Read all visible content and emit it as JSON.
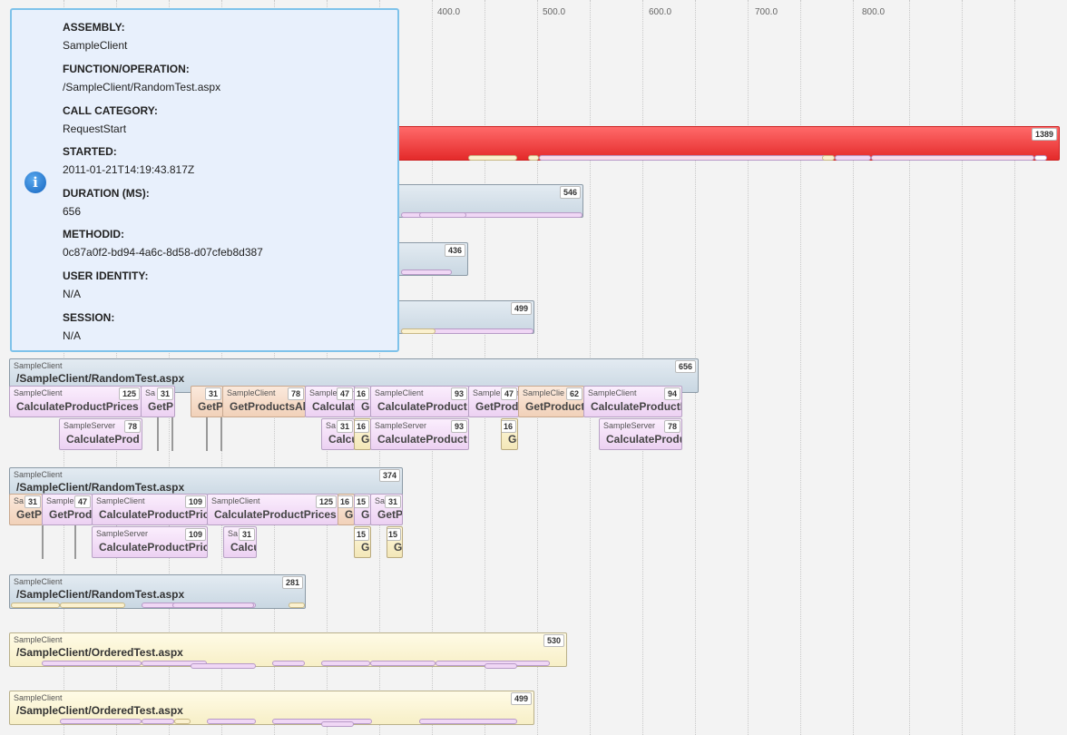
{
  "axis": {
    "ticks": [
      "400.0",
      "500.0",
      "600.0",
      "700.0",
      "800.0"
    ]
  },
  "tooltip": {
    "fields": [
      {
        "label": "ASSEMBLY:",
        "value": "SampleClient"
      },
      {
        "label": "FUNCTION/OPERATION:",
        "value": "/SampleClient/RandomTest.aspx"
      },
      {
        "label": "CALL CATEGORY:",
        "value": "RequestStart"
      },
      {
        "label": "STARTED:",
        "value": "2011-01-21T14:19:43.817Z"
      },
      {
        "label": "DURATION (MS):",
        "value": "656"
      },
      {
        "label": "METHODID:",
        "value": "0c87a0f2-bd94-4a6c-8d58-d07cfeb8d387"
      },
      {
        "label": "USER IDENTITY:",
        "value": "N/A"
      },
      {
        "label": "SESSION:",
        "value": "N/A"
      }
    ]
  },
  "top_bars": [
    {
      "duration": "1389"
    },
    {
      "duration": "546"
    },
    {
      "duration": "436"
    },
    {
      "duration": "499"
    }
  ],
  "request1": {
    "assembly": "SampleClient",
    "function": "/SampleClient/RandomTest.aspx",
    "duration": "656",
    "children": [
      {
        "assembly": "SampleClient",
        "function": "CalculateProductPrices",
        "duration": "125"
      },
      {
        "assembly": "Sa",
        "function": "GetP",
        "duration": "31"
      },
      {
        "assembly": "",
        "function": "GetP",
        "duration": "31"
      },
      {
        "assembly": "SampleClient",
        "function": "GetProductsAl",
        "duration": "78"
      },
      {
        "assembly": "SampleClient",
        "function": "Calculat",
        "duration": "47"
      },
      {
        "assembly": "",
        "function": "Ge",
        "duration": "16"
      },
      {
        "assembly": "SampleClient",
        "function": "CalculateProduct",
        "duration": "93"
      },
      {
        "assembly": "SampleClient",
        "function": "GetProd",
        "duration": "47"
      },
      {
        "assembly": "SampleClie",
        "function": "GetProduct",
        "duration": "62"
      },
      {
        "assembly": "SampleClient",
        "function": "CalculateProductI",
        "duration": "94"
      },
      {
        "assembly": "SampleServer",
        "function": "CalculateProd",
        "duration": "78"
      },
      {
        "assembly": "Sa",
        "function": "Calcu",
        "duration": "31"
      },
      {
        "assembly": "",
        "function": "Ge",
        "duration": "16"
      },
      {
        "assembly": "SampleServer",
        "function": "CalculateProduct",
        "duration": "93"
      },
      {
        "assembly": "",
        "function": "Ge",
        "duration": "16"
      },
      {
        "assembly": "SampleServer",
        "function": "CalculateProdu",
        "duration": "78"
      }
    ]
  },
  "request2": {
    "assembly": "SampleClient",
    "function": "/SampleClient/RandomTest.aspx",
    "duration": "374",
    "children": [
      {
        "assembly": "Sa",
        "function": "GetP",
        "duration": "31"
      },
      {
        "assembly": "Sample",
        "function": "GetProd",
        "duration": "47"
      },
      {
        "assembly": "SampleClient",
        "function": "CalculateProductPric",
        "duration": "109"
      },
      {
        "assembly": "SampleClient",
        "function": "CalculateProductPrices",
        "duration": "125"
      },
      {
        "assembly": "",
        "function": "G",
        "duration": "16"
      },
      {
        "assembly": "",
        "function": "G",
        "duration": "15"
      },
      {
        "assembly": "Sa",
        "function": "GetP",
        "duration": "31"
      },
      {
        "assembly": "SampleServer",
        "function": "CalculateProductPric",
        "duration": "109"
      },
      {
        "assembly": "Sa",
        "function": "Calcu",
        "duration": "31"
      },
      {
        "assembly": "",
        "function": "G",
        "duration": "15"
      },
      {
        "assembly": "",
        "function": "G",
        "duration": "15"
      }
    ]
  },
  "request3": {
    "assembly": "SampleClient",
    "function": "/SampleClient/RandomTest.aspx",
    "duration": "281"
  },
  "request4": {
    "assembly": "SampleClient",
    "function": "/SampleClient/OrderedTest.aspx",
    "duration": "530"
  },
  "request5": {
    "assembly": "SampleClient",
    "function": "/SampleClient/OrderedTest.aspx",
    "duration": "499"
  }
}
